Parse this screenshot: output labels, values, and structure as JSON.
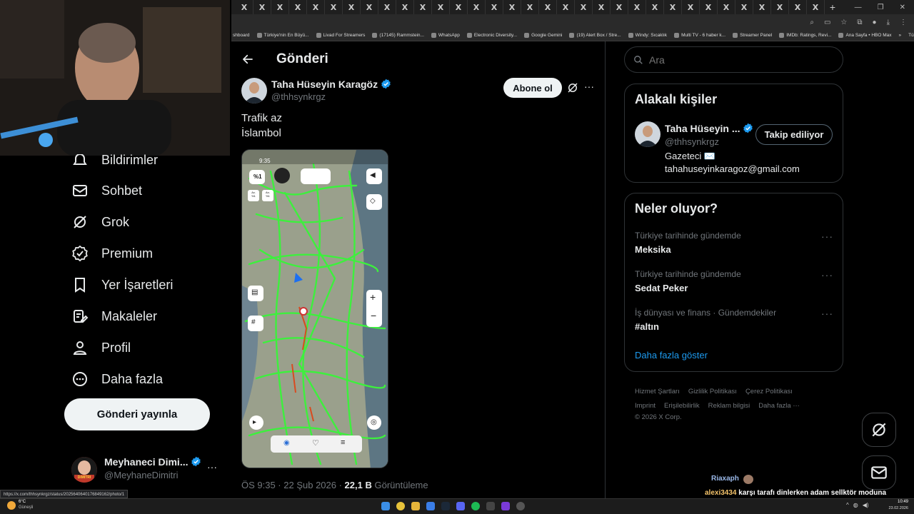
{
  "browser": {
    "tab_glyph": "X",
    "new_tab": "+",
    "bookmarks": [
      "shboard",
      "Türkiye'nin En Büyü...",
      "Livad For Streamers",
      "(17145) Rammstein...",
      "WhatsApp",
      "Electronic Diversity...",
      "Google Gemini",
      "(19) Alert Box / Stre...",
      "Windy: Sıcaklık",
      "Multi TV - 6 haber k...",
      "Streamer Panel",
      "IMDb: Ratings, Revi...",
      "Ana Sayfa • HBO Max"
    ],
    "bookmarks_more": "»",
    "all_bookmarks": "Tüm Yer İşaretleri"
  },
  "nav": {
    "items": [
      {
        "label": "Bildirimler",
        "icon": "bell-icon"
      },
      {
        "label": "Sohbet",
        "icon": "mail-icon"
      },
      {
        "label": "Grok",
        "icon": "grok-icon"
      },
      {
        "label": "Premium",
        "icon": "premium-icon"
      },
      {
        "label": "Yer İşaretleri",
        "icon": "bookmark-icon"
      },
      {
        "label": "Makaleler",
        "icon": "article-icon"
      },
      {
        "label": "Profil",
        "icon": "profile-icon"
      },
      {
        "label": "Daha fazla",
        "icon": "more-icon"
      }
    ],
    "post_button": "Gönderi yayınla",
    "account": {
      "name": "Meyhaneci Dimi...",
      "handle": "@MeyhaneDimitri",
      "avatar_text": "DIMITRI",
      "more": "···"
    }
  },
  "post": {
    "header_title": "Gönderi",
    "author_name": "Taha Hüseyin Karagöz",
    "author_handle": "@thhsynkrgz",
    "subscribe_label": "Abone ol",
    "more": "···",
    "text_line1": "Trafik az",
    "text_line2": "İslambol",
    "meta_time": "ÖS 9:35 · 22 Şub 2026 · ",
    "meta_views": "22,1 B",
    "meta_views_label": " Görüntüleme",
    "map": {
      "status_time": "9:35",
      "percent": "%1",
      "mini1": "Av.\n%1",
      "mini2": "An.\n%1"
    }
  },
  "search": {
    "placeholder": "Ara"
  },
  "related": {
    "title": "Alakalı kişiler",
    "name": "Taha Hüseyin ...",
    "handle": "@thhsynkrgz",
    "follow_label": "Takip ediliyor",
    "bio_line1": "Gazeteci ✉️",
    "bio_line2": "tahahuseyinkaragoz@gmail.com"
  },
  "trends": {
    "title": "Neler oluyor?",
    "items": [
      {
        "meta": "Türkiye tarihinde gündemde",
        "title": "Meksika"
      },
      {
        "meta": "Türkiye tarihinde gündemde",
        "title": "Sedat Peker"
      },
      {
        "meta": "İş dünyası ve finans · Gündemdekiler",
        "title": "#altın"
      }
    ],
    "show_more": "Daha fazla göster"
  },
  "footer": {
    "links": [
      "Hizmet Şartları",
      "Gizlilik Politikası",
      "Çerez Politikası",
      "Imprint",
      "Erişilebilirlik",
      "Reklam bilgisi",
      "Daha fazla ···"
    ],
    "copyright": "© 2026 X Corp."
  },
  "chat": {
    "user1": "Riaxaph",
    "user2": "alexi3434",
    "message": "karşı tarafı dinlerken adam sellktör moduna giriyo asddsaasd"
  },
  "status_url": "https://x.com/thhsynkrgz/status/2025640640176849162/photo/1",
  "taskbar": {
    "weather_temp": "6°C",
    "weather_desc": "Güneşli",
    "time": "10:49",
    "date": "23.02.2026"
  },
  "colors": {
    "accent": "#1d9bf0",
    "bg": "#000000",
    "border": "#2f3336",
    "muted": "#71767b"
  }
}
